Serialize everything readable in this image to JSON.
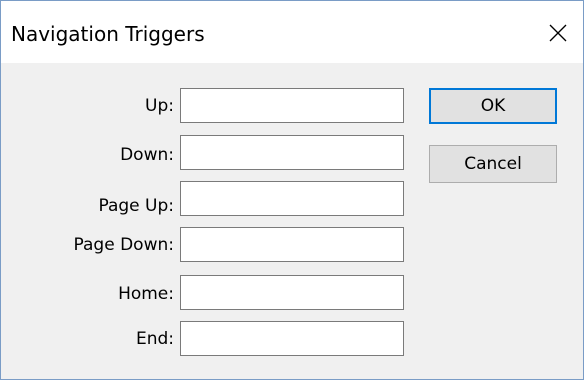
{
  "window": {
    "title": "Navigation Triggers",
    "close_icon": "close-icon"
  },
  "form": {
    "fields": [
      {
        "label": "Up:",
        "value": "",
        "placeholder": ""
      },
      {
        "label": "Down:",
        "value": "",
        "placeholder": ""
      },
      {
        "label": "Page Up:",
        "value": "",
        "placeholder": ""
      },
      {
        "label": "Page Down:",
        "value": "",
        "placeholder": ""
      },
      {
        "label": "Home:",
        "value": "",
        "placeholder": ""
      },
      {
        "label": "End:",
        "value": "",
        "placeholder": ""
      }
    ]
  },
  "buttons": {
    "ok_label": "OK",
    "cancel_label": "Cancel"
  },
  "colors": {
    "accent": "#0078d7",
    "window_border": "#7a9cc6",
    "client_background": "#f0f0f0"
  }
}
